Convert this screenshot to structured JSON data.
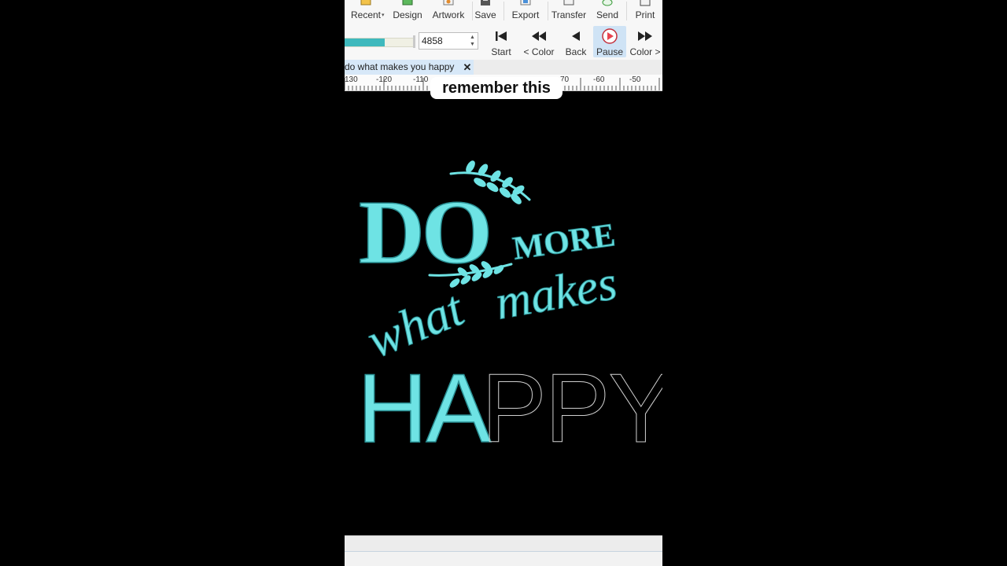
{
  "ribbon": {
    "items": [
      {
        "label": "Recent",
        "icon": "recent-icon",
        "has_dropdown": true
      },
      {
        "label": "Design",
        "icon": "design-icon"
      },
      {
        "label": "Artwork",
        "icon": "artwork-icon"
      },
      {
        "label": "Save",
        "icon": "save-icon"
      },
      {
        "label": "Export",
        "icon": "export-icon"
      },
      {
        "label": "Transfer",
        "icon": "transfer-icon"
      },
      {
        "label": "Send",
        "icon": "send-icon"
      },
      {
        "label": "Print",
        "icon": "print-icon"
      }
    ]
  },
  "stitch_player": {
    "progress": 0.58,
    "stitch_count": "4858",
    "buttons": [
      {
        "label": "Start",
        "icon": "skip-to-start-icon"
      },
      {
        "label": "< Color",
        "icon": "previous-color-icon"
      },
      {
        "label": "Back",
        "icon": "step-back-icon"
      },
      {
        "label": "Pause",
        "icon": "pause-play-icon",
        "active": true
      },
      {
        "label": "Color >",
        "icon": "next-color-icon"
      }
    ]
  },
  "document_tab": {
    "title": "do what makes you happy",
    "close_glyph": "✕"
  },
  "ruler": {
    "labels": [
      "130",
      "-120",
      "-110",
      "70",
      "-60",
      "-50"
    ]
  },
  "caption": {
    "text": "remember this"
  },
  "design": {
    "words": {
      "do": "DO",
      "more": "MORE",
      "what": "what",
      "makes": "makes",
      "happy_stitched": "HA",
      "happy_outline": "PPY"
    },
    "thread_color": "#6ee3e4",
    "thread_shadow": "#2a8f93",
    "outline_color": "#cfcfcf"
  },
  "colors": {
    "accent": "#3fb9bd",
    "active_button": "#cfe3f5",
    "pause_red": "#e8434f"
  }
}
